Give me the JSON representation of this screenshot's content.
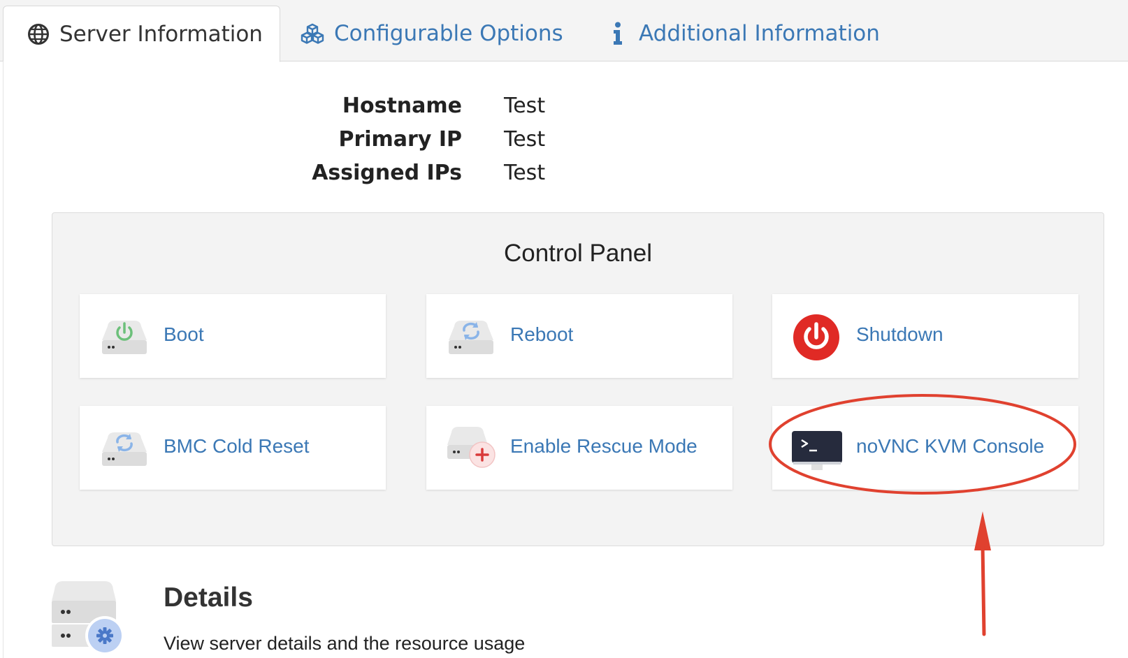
{
  "tabs": [
    {
      "label": "Server Information",
      "icon": "globe-icon",
      "active": true
    },
    {
      "label": "Configurable Options",
      "icon": "cubes-icon",
      "active": false
    },
    {
      "label": "Additional Information",
      "icon": "info-icon",
      "active": false
    }
  ],
  "server_info": [
    {
      "label": "Hostname",
      "value": "Test"
    },
    {
      "label": "Primary IP",
      "value": "Test"
    },
    {
      "label": "Assigned IPs",
      "value": "Test"
    }
  ],
  "control_panel": {
    "title": "Control Panel",
    "actions": [
      {
        "label": "Boot",
        "icon": "boot-server-icon"
      },
      {
        "label": "Reboot",
        "icon": "reboot-server-icon"
      },
      {
        "label": "Shutdown",
        "icon": "power-icon"
      },
      {
        "label": "BMC Cold Reset",
        "icon": "bmc-reset-server-icon"
      },
      {
        "label": "Enable Rescue Mode",
        "icon": "rescue-server-icon"
      },
      {
        "label": "noVNC KVM Console",
        "icon": "terminal-monitor-icon"
      }
    ]
  },
  "details": {
    "title": "Details",
    "description": "View server details and the resource usage"
  },
  "colors": {
    "link": "#3b78b5",
    "annotation": "#e0412f",
    "shutdown_red": "#e02a25"
  }
}
